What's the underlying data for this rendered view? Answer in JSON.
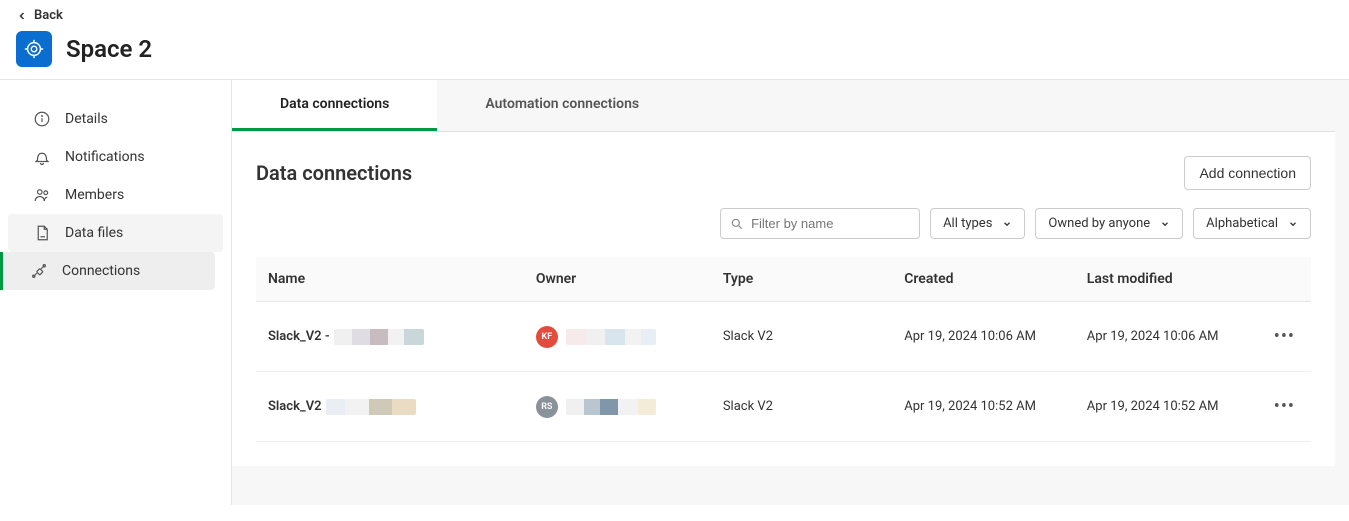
{
  "header": {
    "back_label": "Back",
    "space_title": "Space 2"
  },
  "sidebar": {
    "items": [
      {
        "label": "Details"
      },
      {
        "label": "Notifications"
      },
      {
        "label": "Members"
      },
      {
        "label": "Data files"
      },
      {
        "label": "Connections"
      }
    ]
  },
  "tabs": [
    {
      "label": "Data connections"
    },
    {
      "label": "Automation connections"
    }
  ],
  "panel": {
    "title": "Data connections",
    "add_button": "Add connection",
    "filters": {
      "search_placeholder": "Filter by name",
      "type_filter": "All types",
      "owner_filter": "Owned by anyone",
      "sort_filter": "Alphabetical"
    },
    "columns": {
      "name": "Name",
      "owner": "Owner",
      "type": "Type",
      "created": "Created",
      "modified": "Last modified"
    },
    "rows": [
      {
        "name_prefix": "Slack_V2 -",
        "owner_initials": "KF",
        "type": "Slack V2",
        "created": "Apr 19, 2024 10:06 AM",
        "modified": "Apr 19, 2024 10:06 AM"
      },
      {
        "name_prefix": "Slack_V2",
        "owner_initials": "RS",
        "type": "Slack V2",
        "created": "Apr 19, 2024 10:52 AM",
        "modified": "Apr 19, 2024 10:52 AM"
      }
    ]
  }
}
